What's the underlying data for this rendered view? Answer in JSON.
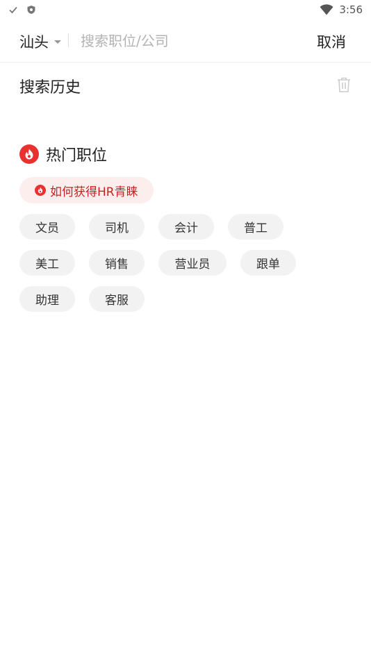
{
  "status_bar": {
    "time": "3:56",
    "left_icons": [
      "check-icon",
      "shield-icon"
    ],
    "right_icons": [
      "wifi-icon"
    ]
  },
  "search_bar": {
    "city": "汕头",
    "placeholder": "搜索职位/公司",
    "value": "",
    "cancel_label": "取消"
  },
  "history": {
    "title": "搜索历史",
    "clear_icon": "trash-icon"
  },
  "hot": {
    "title": "热门职位",
    "icon": "flame-icon",
    "tip": "如何获得HR青睐",
    "tags": [
      "文员",
      "司机",
      "会计",
      "普工",
      "美工",
      "销售",
      "营业员",
      "跟单",
      "助理",
      "客服"
    ]
  },
  "colors": {
    "accent": "#e8322f",
    "tip_bg": "#fdeeee",
    "tip_text": "#cc1f1f",
    "tag_bg": "#f2f2f2"
  }
}
